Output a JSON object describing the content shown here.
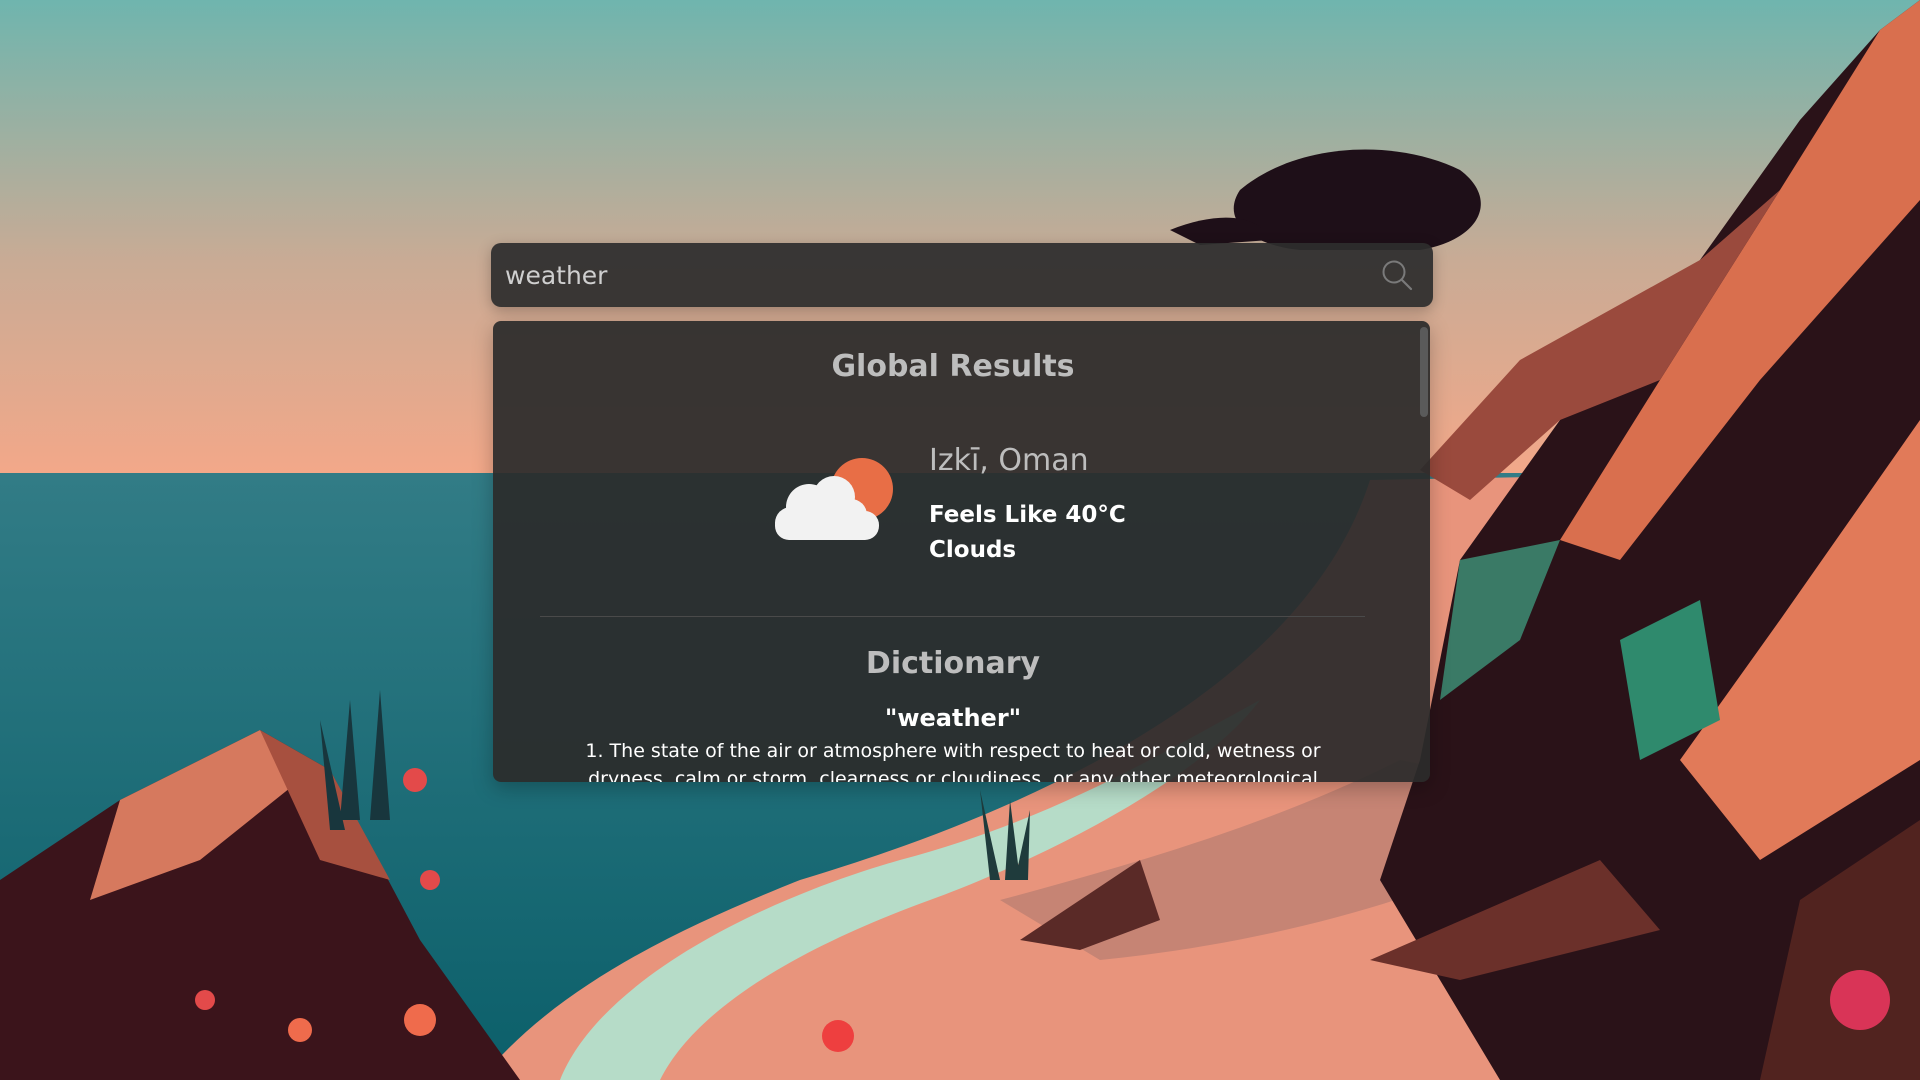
{
  "search": {
    "value": "weather",
    "button_icon": "search-icon"
  },
  "results": {
    "global_title": "Global Results",
    "weather": {
      "location": "Izkī, Oman",
      "feels_like": "Feels Like 40°C",
      "condition": "Clouds",
      "icon": "partly-cloudy-icon"
    },
    "dictionary": {
      "title": "Dictionary",
      "word": "\"weather\"",
      "definition": "1. The state of the air or atmosphere with respect to heat or cold, wetness or dryness, calm or storm, clearness or cloudiness, or any other meteorological"
    }
  },
  "colors": {
    "sky_top": "#6fb5ae",
    "sky_horizon": "#f3a889",
    "sea": "#12707a",
    "panel": "#2b2b2b",
    "sun": "#e86e46"
  }
}
